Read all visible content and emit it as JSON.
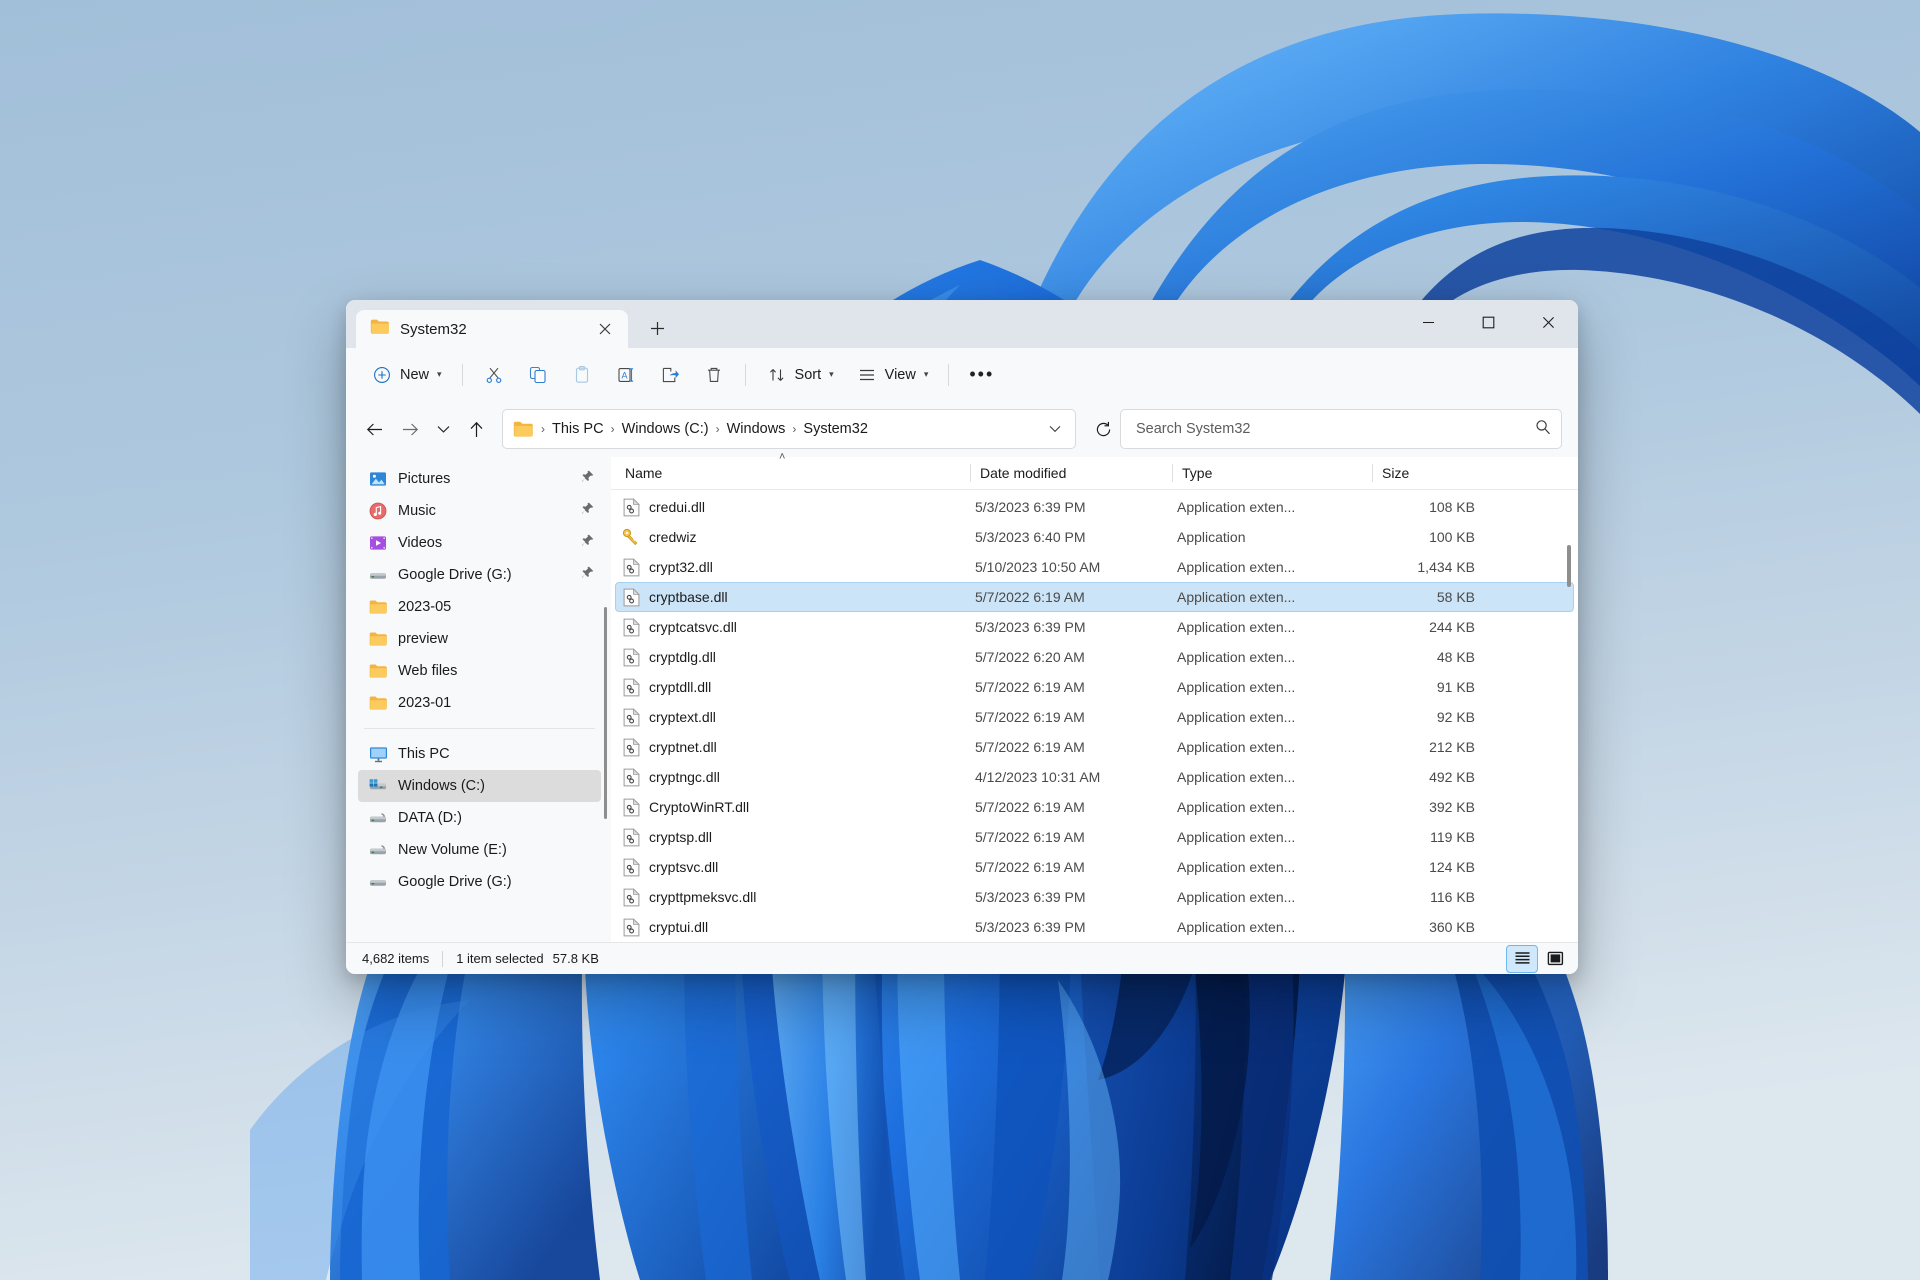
{
  "window": {
    "tab_title": "System32",
    "tab_close_icon": "close-icon",
    "new_tab_icon": "plus-icon",
    "minimize_label": "–",
    "maximize_label": "□",
    "close_label": "✕"
  },
  "toolbar": {
    "new_label": "New",
    "new_icon": "plus-circle-icon",
    "cut_icon": "scissors-icon",
    "copy_icon": "copy-icon",
    "paste_icon": "clipboard-icon",
    "rename_icon": "rename-icon",
    "share_icon": "share-icon",
    "delete_icon": "trash-icon",
    "sort_label": "Sort",
    "sort_icon": "sort-arrows-icon",
    "view_label": "View",
    "view_icon": "lines-icon",
    "more_label": "•••"
  },
  "address": {
    "back_icon": "arrow-left-icon",
    "forward_icon": "arrow-right-icon",
    "recent_icon": "chevron-down-icon",
    "up_icon": "arrow-up-icon",
    "folder_icon": "folder-icon",
    "breadcrumbs": [
      "This PC",
      "Windows (C:)",
      "Windows",
      "System32"
    ],
    "separator": "›",
    "dropdown_icon": "chevron-down-icon",
    "refresh_icon": "refresh-icon"
  },
  "search": {
    "placeholder": "Search System32",
    "value": "",
    "icon": "search-icon"
  },
  "sidebar": {
    "group_one": [
      {
        "label": "Pictures",
        "icon": "pictures-icon",
        "pinned": true
      },
      {
        "label": "Music",
        "icon": "music-icon",
        "pinned": true
      },
      {
        "label": "Videos",
        "icon": "videos-icon",
        "pinned": true
      },
      {
        "label": "Google Drive (G:)",
        "icon": "drive-icon",
        "pinned": true
      },
      {
        "label": "2023-05",
        "icon": "folder-icon",
        "pinned": false
      },
      {
        "label": "preview",
        "icon": "folder-icon",
        "pinned": false
      },
      {
        "label": "Web files",
        "icon": "folder-icon",
        "pinned": false
      },
      {
        "label": "2023-01",
        "icon": "folder-icon",
        "pinned": false
      }
    ],
    "group_two": [
      {
        "label": "This PC",
        "icon": "this-pc-icon",
        "selected": false
      },
      {
        "label": "Windows (C:)",
        "icon": "windows-drive-icon",
        "selected": true
      },
      {
        "label": "DATA (D:)",
        "icon": "hdd-icon",
        "selected": false
      },
      {
        "label": "New Volume (E:)",
        "icon": "hdd-icon",
        "selected": false
      },
      {
        "label": "Google Drive (G:)",
        "icon": "drive-icon",
        "selected": false
      }
    ],
    "pin_icon": "pin-icon"
  },
  "filelist": {
    "columns": [
      "Name",
      "Date modified",
      "Type",
      "Size"
    ],
    "sort_indicator": "˄",
    "rows": [
      {
        "name": "credui.dll",
        "date": "5/3/2023 6:39 PM",
        "type": "Application exten...",
        "size": "108 KB",
        "icon": "dll-icon",
        "selected": false
      },
      {
        "name": "credwiz",
        "date": "5/3/2023 6:40 PM",
        "type": "Application",
        "size": "100 KB",
        "icon": "key-icon",
        "selected": false
      },
      {
        "name": "crypt32.dll",
        "date": "5/10/2023 10:50 AM",
        "type": "Application exten...",
        "size": "1,434 KB",
        "icon": "dll-icon",
        "selected": false
      },
      {
        "name": "cryptbase.dll",
        "date": "5/7/2022 6:19 AM",
        "type": "Application exten...",
        "size": "58 KB",
        "icon": "dll-icon",
        "selected": true
      },
      {
        "name": "cryptcatsvc.dll",
        "date": "5/3/2023 6:39 PM",
        "type": "Application exten...",
        "size": "244 KB",
        "icon": "dll-icon",
        "selected": false
      },
      {
        "name": "cryptdlg.dll",
        "date": "5/7/2022 6:20 AM",
        "type": "Application exten...",
        "size": "48 KB",
        "icon": "dll-icon",
        "selected": false
      },
      {
        "name": "cryptdll.dll",
        "date": "5/7/2022 6:19 AM",
        "type": "Application exten...",
        "size": "91 KB",
        "icon": "dll-icon",
        "selected": false
      },
      {
        "name": "cryptext.dll",
        "date": "5/7/2022 6:19 AM",
        "type": "Application exten...",
        "size": "92 KB",
        "icon": "dll-icon",
        "selected": false
      },
      {
        "name": "cryptnet.dll",
        "date": "5/7/2022 6:19 AM",
        "type": "Application exten...",
        "size": "212 KB",
        "icon": "dll-icon",
        "selected": false
      },
      {
        "name": "cryptngc.dll",
        "date": "4/12/2023 10:31 AM",
        "type": "Application exten...",
        "size": "492 KB",
        "icon": "dll-icon",
        "selected": false
      },
      {
        "name": "CryptoWinRT.dll",
        "date": "5/7/2022 6:19 AM",
        "type": "Application exten...",
        "size": "392 KB",
        "icon": "dll-icon",
        "selected": false
      },
      {
        "name": "cryptsp.dll",
        "date": "5/7/2022 6:19 AM",
        "type": "Application exten...",
        "size": "119 KB",
        "icon": "dll-icon",
        "selected": false
      },
      {
        "name": "cryptsvc.dll",
        "date": "5/7/2022 6:19 AM",
        "type": "Application exten...",
        "size": "124 KB",
        "icon": "dll-icon",
        "selected": false
      },
      {
        "name": "crypttpmeksvc.dll",
        "date": "5/3/2023 6:39 PM",
        "type": "Application exten...",
        "size": "116 KB",
        "icon": "dll-icon",
        "selected": false
      },
      {
        "name": "cryptui.dll",
        "date": "5/3/2023 6:39 PM",
        "type": "Application exten...",
        "size": "360 KB",
        "icon": "dll-icon",
        "selected": false
      }
    ]
  },
  "status": {
    "item_count": "4,682 items",
    "selection": "1 item selected",
    "selection_size": "57.8 KB",
    "details_view_icon": "details-view-icon",
    "large_icons_view_icon": "large-icons-view-icon"
  },
  "colors": {
    "accent": "#0078d4",
    "selection_fill": "#cce4f7",
    "selection_border": "#a8d1f0",
    "window_chrome": "#f7f9fa",
    "titlebar": "#dfe5ea",
    "sidebar_selected": "#dcdcdc"
  }
}
